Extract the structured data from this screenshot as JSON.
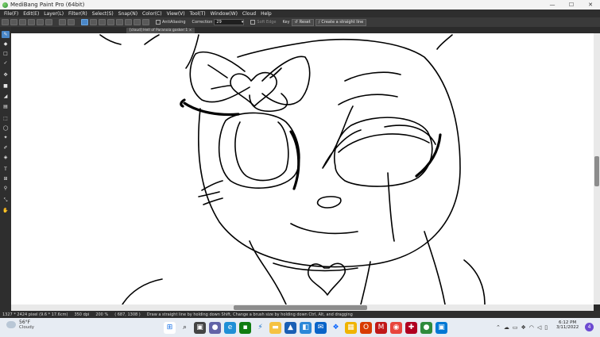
{
  "window": {
    "title": "MediBang Paint Pro (64bit)",
    "controls": {
      "minimize": "—",
      "maximize": "☐",
      "close": "✕"
    }
  },
  "menu": [
    "File(F)",
    "Edit(E)",
    "Layer(L)",
    "Filter(R)",
    "Select(S)",
    "Snap(N)",
    "Color(C)",
    "View(V)",
    "Tool(T)",
    "Window(W)",
    "Cloud",
    "Help"
  ],
  "toolbar": {
    "antialiasing_label": "AntiAliasing",
    "correction_label": "Correction",
    "correction_value": "29",
    "soft_edge_label": "Soft Edge",
    "key_label": "Key",
    "reset_label": "Reset",
    "straight_line_label": "Create a straight line"
  },
  "document": {
    "tab_label": "[cloud] Hell of Paranoia gosker:1 ×"
  },
  "statusbar": {
    "dimensions": "1327 * 2424 pixel  (9.6 * 17.6cm)",
    "dpi": "350 dpi",
    "zoom": "200 %",
    "cursor": "( 687, 1308 )",
    "hint": "Draw a straight line by holding down Shift, Change a brush size by holding down Ctrl, Alt, and dragging"
  },
  "taskbar": {
    "weather_temp": "56°F",
    "weather_condition": "Cloudy",
    "time": "6:12 PM",
    "date": "3/11/2022",
    "notification_count": "4"
  },
  "colors": {
    "accent": "#4a87c8",
    "canvas": "#ffffff",
    "line": "#000000"
  }
}
